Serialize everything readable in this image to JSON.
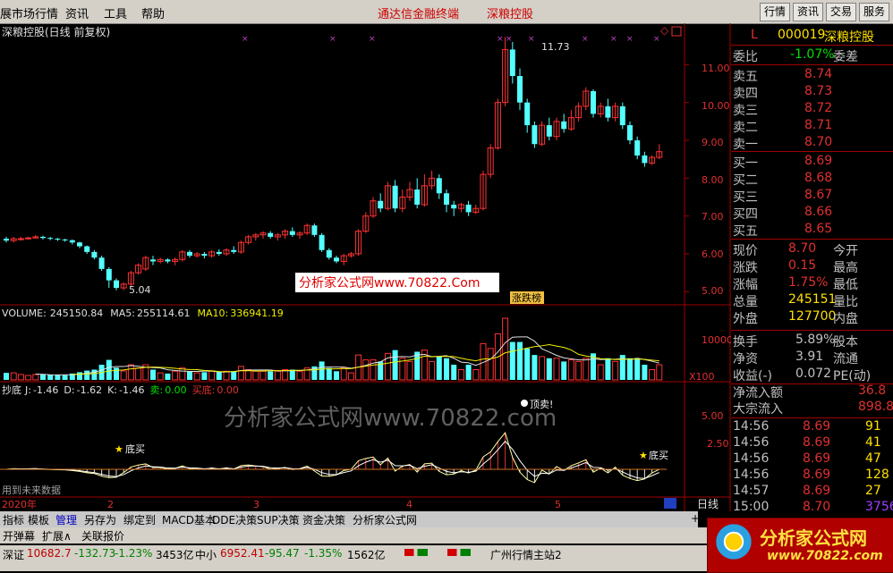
{
  "menubar": {
    "items": [
      "展市场行情",
      "资讯",
      "工具",
      "帮助"
    ],
    "center": [
      "通达信金融终端",
      "深粮控股"
    ],
    "buttons": [
      "行情",
      "资讯",
      "交易",
      "服务"
    ]
  },
  "main_chart": {
    "title": "深粮控股(日线 前复权)",
    "y_ticks": [
      "11.00",
      "10.00",
      "9.00",
      "8.00",
      "7.00",
      "6.00",
      "5.00"
    ],
    "high_label": "11.73",
    "low_label": "5.04",
    "watermark": "分析家公式网www.70822.Com",
    "tag": "涨跌榜"
  },
  "volume_chart": {
    "label": "VOLUME:",
    "volume": "245150.84",
    "ma5_label": "MA5:",
    "ma5": "255114.61",
    "ma10_label": "MA10:",
    "ma10": "336941.19",
    "y_tick": "10000",
    "unit": "X100"
  },
  "indicator_chart": {
    "name": "抄底",
    "j_label": "J:",
    "j": "-1.46",
    "d_label": "D:",
    "d": "-1.62",
    "k_label": "K:",
    "k": "-1.46",
    "sell_label": "卖:",
    "sell": "0.00",
    "buy_label": "买底:",
    "buy": "0.00",
    "y_ticks": [
      "5.00",
      "2.50"
    ],
    "signal_buy": "底买",
    "signal_sell": "顶卖!",
    "note": "用到未来数据",
    "watermark": "分析家公式网www.70822.com"
  },
  "x_axis": {
    "labels": [
      "2020年",
      "2",
      "3",
      "4",
      "5"
    ],
    "period": "日线"
  },
  "chart_data": {
    "type": "candlestick",
    "title": "深粮控股(日线 前复权)",
    "ylim": [
      4.7,
      12.0
    ],
    "y_ticks": [
      11,
      10,
      9,
      8,
      7,
      6,
      5
    ],
    "x_labels": [
      "2020年",
      "2",
      "3",
      "4",
      "5"
    ],
    "bars": [
      [
        6.4,
        6.35,
        6.45,
        6.3
      ],
      [
        6.35,
        6.4,
        6.45,
        6.3
      ],
      [
        6.4,
        6.4,
        6.45,
        6.35
      ],
      [
        6.4,
        6.42,
        6.45,
        6.38
      ],
      [
        6.42,
        6.45,
        6.5,
        6.4
      ],
      [
        6.45,
        6.42,
        6.48,
        6.38
      ],
      [
        6.42,
        6.4,
        6.45,
        6.36
      ],
      [
        6.4,
        6.38,
        6.42,
        6.34
      ],
      [
        6.38,
        6.36,
        6.4,
        6.32
      ],
      [
        6.36,
        6.3,
        6.38,
        6.25
      ],
      [
        6.3,
        6.2,
        6.32,
        6.15
      ],
      [
        6.2,
        6.05,
        6.22,
        6.0
      ],
      [
        6.05,
        5.9,
        6.1,
        5.85
      ],
      [
        5.9,
        5.6,
        5.95,
        5.55
      ],
      [
        5.6,
        5.3,
        5.65,
        5.1
      ],
      [
        5.3,
        5.1,
        5.35,
        5.04
      ],
      [
        5.1,
        5.2,
        5.25,
        5.04
      ],
      [
        5.2,
        5.5,
        5.55,
        5.15
      ],
      [
        5.5,
        5.7,
        5.75,
        5.45
      ],
      [
        5.6,
        5.9,
        5.95,
        5.55
      ],
      [
        5.85,
        5.8,
        5.95,
        5.7
      ],
      [
        5.8,
        5.85,
        5.9,
        5.75
      ],
      [
        5.85,
        5.8,
        5.88,
        5.75
      ],
      [
        5.8,
        5.85,
        5.9,
        5.7
      ],
      [
        5.85,
        6.05,
        6.1,
        5.8
      ],
      [
        6.05,
        5.95,
        6.1,
        5.9
      ],
      [
        5.95,
        6.0,
        6.05,
        5.9
      ],
      [
        6.0,
        5.95,
        6.05,
        5.88
      ],
      [
        5.95,
        6.05,
        6.1,
        5.9
      ],
      [
        6.05,
        6.0,
        6.12,
        5.95
      ],
      [
        6.0,
        6.1,
        6.15,
        5.95
      ],
      [
        6.1,
        6.05,
        6.2,
        6.0
      ],
      [
        6.05,
        6.3,
        6.35,
        6.0
      ],
      [
        6.3,
        6.45,
        6.5,
        6.25
      ],
      [
        6.45,
        6.5,
        6.55,
        6.35
      ],
      [
        6.5,
        6.55,
        6.6,
        6.4
      ],
      [
        6.55,
        6.45,
        6.6,
        6.4
      ],
      [
        6.45,
        6.5,
        6.55,
        6.35
      ],
      [
        6.5,
        6.6,
        6.65,
        6.4
      ],
      [
        6.6,
        6.5,
        6.7,
        6.45
      ],
      [
        6.5,
        6.55,
        6.6,
        6.4
      ],
      [
        6.55,
        6.75,
        6.8,
        6.5
      ],
      [
        6.75,
        6.5,
        6.8,
        6.45
      ],
      [
        6.5,
        6.1,
        6.55,
        6.05
      ],
      [
        6.1,
        5.9,
        6.15,
        5.85
      ],
      [
        5.9,
        5.8,
        5.95,
        5.75
      ],
      [
        5.8,
        5.95,
        6.0,
        5.7
      ],
      [
        5.95,
        6.0,
        6.05,
        5.9
      ],
      [
        6.0,
        6.6,
        6.65,
        5.95
      ],
      [
        6.6,
        7.0,
        7.1,
        6.55
      ],
      [
        7.0,
        7.4,
        7.5,
        6.95
      ],
      [
        7.4,
        7.2,
        7.6,
        7.1
      ],
      [
        7.2,
        7.8,
        7.9,
        7.15
      ],
      [
        7.8,
        7.2,
        7.95,
        7.1
      ],
      [
        7.2,
        7.5,
        7.7,
        7.1
      ],
      [
        7.5,
        7.7,
        7.9,
        7.4
      ],
      [
        7.7,
        7.3,
        8.0,
        7.2
      ],
      [
        7.3,
        7.8,
        8.1,
        7.25
      ],
      [
        7.8,
        8.0,
        8.2,
        7.7
      ],
      [
        8.0,
        7.6,
        8.1,
        7.45
      ],
      [
        7.6,
        7.3,
        7.7,
        7.1
      ],
      [
        7.3,
        7.2,
        7.4,
        7.0
      ],
      [
        7.2,
        7.3,
        7.35,
        7.1
      ],
      [
        7.3,
        7.1,
        7.4,
        7.0
      ],
      [
        7.1,
        7.2,
        7.3,
        7.05
      ],
      [
        7.2,
        8.1,
        8.2,
        7.15
      ],
      [
        8.1,
        8.8,
        8.9,
        8.0
      ],
      [
        8.8,
        10.0,
        10.1,
        8.75
      ],
      [
        10.0,
        11.4,
        11.73,
        9.9
      ],
      [
        11.4,
        10.7,
        11.6,
        10.5
      ],
      [
        10.7,
        10.0,
        10.9,
        9.8
      ],
      [
        10.0,
        9.4,
        10.1,
        9.2
      ],
      [
        9.4,
        8.9,
        9.5,
        8.8
      ],
      [
        8.9,
        9.4,
        9.5,
        8.85
      ],
      [
        9.4,
        9.1,
        9.6,
        9.0
      ],
      [
        9.1,
        9.5,
        9.6,
        9.0
      ],
      [
        9.5,
        9.3,
        9.7,
        9.2
      ],
      [
        9.3,
        9.6,
        9.8,
        9.25
      ],
      [
        9.6,
        9.9,
        10.0,
        9.5
      ],
      [
        9.9,
        10.3,
        10.4,
        9.8
      ],
      [
        10.3,
        9.7,
        10.35,
        9.6
      ],
      [
        9.7,
        9.9,
        10.0,
        9.6
      ],
      [
        9.9,
        9.6,
        10.1,
        9.5
      ],
      [
        9.6,
        9.9,
        10.0,
        9.5
      ],
      [
        9.9,
        9.4,
        10.0,
        9.3
      ],
      [
        9.4,
        9.0,
        9.5,
        8.9
      ],
      [
        9.0,
        8.6,
        9.1,
        8.5
      ],
      [
        8.6,
        8.4,
        8.7,
        8.3
      ],
      [
        8.4,
        8.55,
        8.6,
        8.35
      ],
      [
        8.55,
        8.7,
        8.9,
        8.5
      ]
    ],
    "volume": {
      "y_tick": 10000,
      "ma5": 255114.61,
      "ma10": 336941.19,
      "last": 245150.84
    },
    "indicator": {
      "y_ticks": [
        5.0,
        2.5
      ],
      "j": -1.46,
      "d": -1.62,
      "k": -1.46
    }
  },
  "quote": {
    "code_prefix": "L",
    "code": "000019",
    "name": "深粮控股",
    "webi_label": "委比",
    "webi": "-1.07%",
    "wecha_label": "委差",
    "sells": [
      {
        "label": "卖五",
        "price": "8.74"
      },
      {
        "label": "卖四",
        "price": "8.73"
      },
      {
        "label": "卖三",
        "price": "8.72"
      },
      {
        "label": "卖二",
        "price": "8.71"
      },
      {
        "label": "卖一",
        "price": "8.70"
      }
    ],
    "buys": [
      {
        "label": "买一",
        "price": "8.69"
      },
      {
        "label": "买二",
        "price": "8.68"
      },
      {
        "label": "买三",
        "price": "8.67"
      },
      {
        "label": "买四",
        "price": "8.66"
      },
      {
        "label": "买五",
        "price": "8.65"
      }
    ],
    "stats": [
      {
        "l": "现价",
        "v": "8.70",
        "r": "今开"
      },
      {
        "l": "涨跌",
        "v": "0.15",
        "r": "最高"
      },
      {
        "l": "涨幅",
        "v": "1.75%",
        "r": "最低"
      },
      {
        "l": "总量",
        "v": "245151",
        "r": "量比"
      },
      {
        "l": "外盘",
        "v": "127700",
        "r": "内盘"
      }
    ],
    "stats2": [
      {
        "l": "换手",
        "v": "5.89%",
        "r": "股本"
      },
      {
        "l": "净资",
        "v": "3.91",
        "r": "流通"
      },
      {
        "l": "收益(-)",
        "v": "0.072",
        "r": "PE(动)"
      }
    ],
    "flow": [
      {
        "l": "净流入额",
        "v": "36.8"
      },
      {
        "l": "大宗流入",
        "v": "898.8"
      }
    ],
    "ticks": [
      {
        "t": "14:56",
        "p": "8.69",
        "v": "91"
      },
      {
        "t": "14:56",
        "p": "8.69",
        "v": "41"
      },
      {
        "t": "14:56",
        "p": "8.69",
        "v": "47"
      },
      {
        "t": "14:56",
        "p": "8.69",
        "v": "128"
      },
      {
        "t": "14:57",
        "p": "8.69",
        "v": "27"
      },
      {
        "t": "15:00",
        "p": "8.70",
        "v": "3756"
      }
    ]
  },
  "bottom_tabs": [
    "指标",
    "模板",
    "管理",
    "另存为",
    "绑定到",
    "MACD基本",
    "DDE决策",
    "SUP决策",
    "资金决策",
    "分析家公式网"
  ],
  "bar2": [
    "开弹幕",
    "扩展∧",
    "关联报价"
  ],
  "status": {
    "sz_label": "深证",
    "sz_value": "10682.7",
    "sz_change": "-132.73",
    "sz_pct": "-1.23%",
    "sz_amount": "3453亿",
    "zx_label": "中小",
    "zx_value": "6952.41",
    "zx_change": "-95.47",
    "zx_pct": "-1.35%",
    "zx_amount": "1562亿",
    "server": "广州行情主站2"
  },
  "logo": {
    "text": "分析家公式网",
    "url": "www.70822.com"
  }
}
